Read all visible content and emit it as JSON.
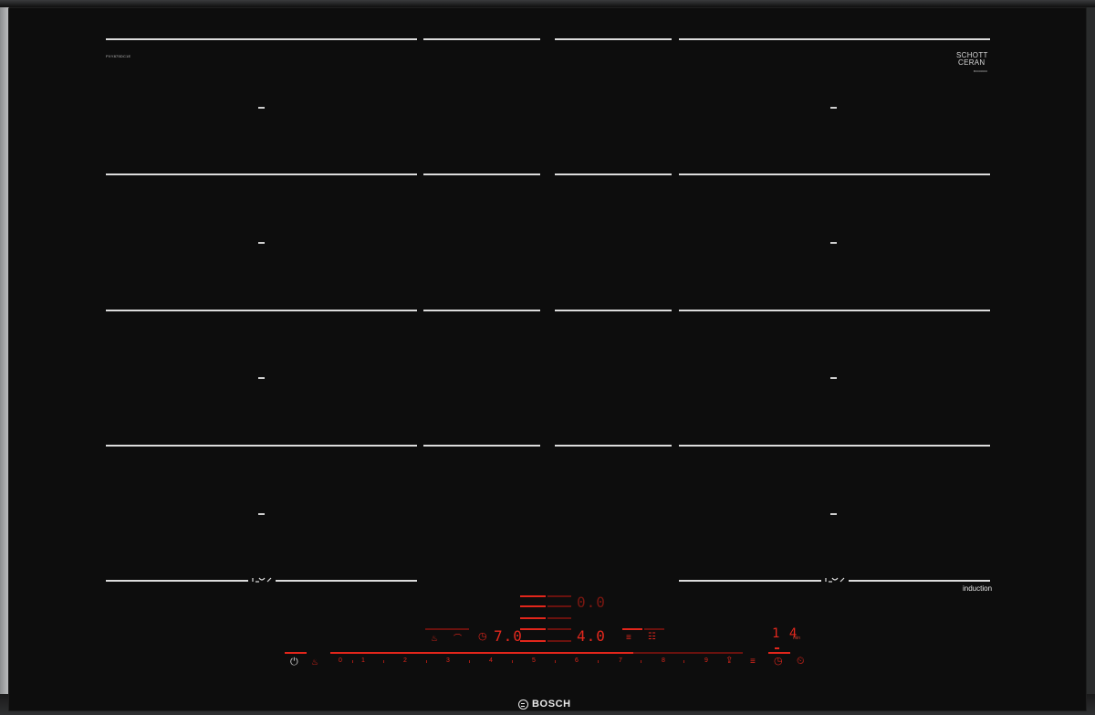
{
  "hob": {
    "model_code": "PXY875DC1E",
    "glass_brand": {
      "line1": "SCHOTT",
      "line2": "CERAN",
      "sub": "B0000000"
    },
    "induction_label": "induction",
    "brand_name": "BOSCH"
  },
  "controls": {
    "timer_left_display": "0.0",
    "power_display_left": "7.0",
    "power_display_right": "4.0",
    "timer_display_right": "1 4",
    "timer_unit": "min",
    "scale": [
      "0",
      "1",
      "2",
      "3",
      "4",
      "5",
      "6",
      "7",
      "8",
      "9"
    ],
    "icons": {
      "power": "power-icon",
      "child_lock": "child-lock-icon",
      "pot": "pot-icon",
      "pan": "pan-icon",
      "clock": "clock-icon",
      "stack": "menu-icon",
      "sensor": "sensor-icon",
      "boost": "boost-icon",
      "timer": "timer-icon",
      "alarm": "alarm-icon"
    }
  },
  "colors": {
    "glass": "#0d0d0d",
    "line": "#dcdcdc",
    "display_red": "#e3281d"
  }
}
